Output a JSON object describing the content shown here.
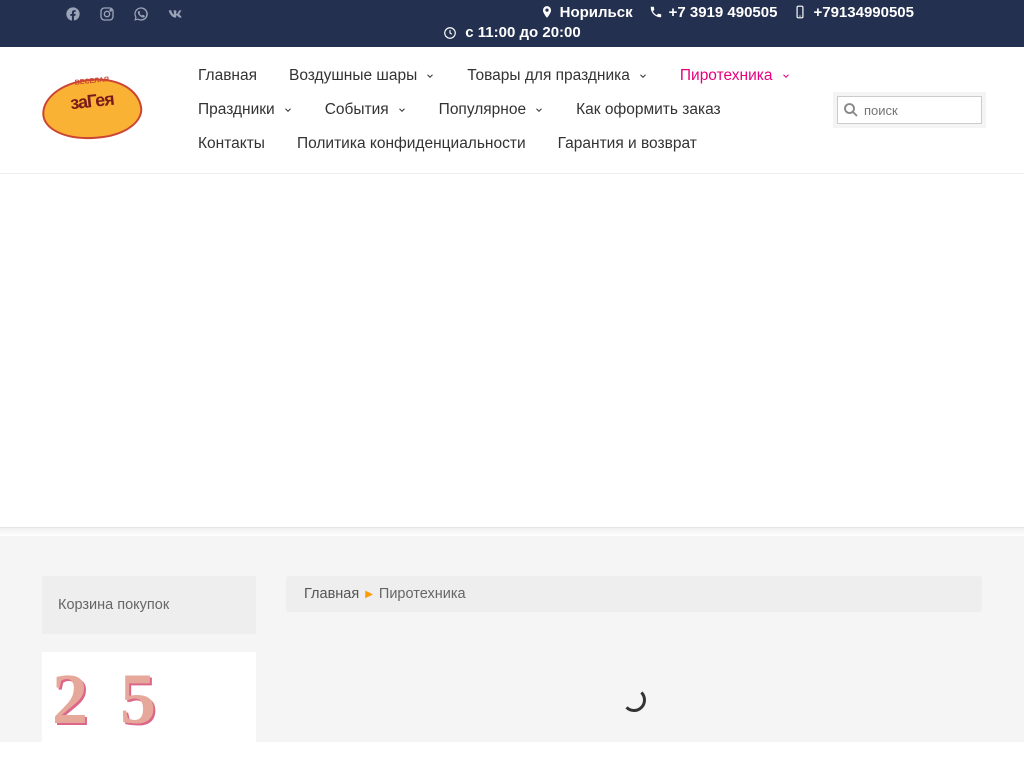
{
  "topbar": {
    "city": "Норильск",
    "phone1": "+7 3919 490505",
    "phone2": "+79134990505",
    "hours": "с 11:00 до 20:00"
  },
  "logo": {
    "main": "заГея",
    "sub": "ВЕСЕЛАЯ"
  },
  "nav": {
    "items": [
      {
        "label": "Главная",
        "dropdown": false,
        "active": false
      },
      {
        "label": "Воздушные шары",
        "dropdown": true,
        "active": false
      },
      {
        "label": "Товары для праздника",
        "dropdown": true,
        "active": false
      },
      {
        "label": "Пиротехника",
        "dropdown": true,
        "active": true
      },
      {
        "label": "Праздники",
        "dropdown": true,
        "active": false
      },
      {
        "label": "События",
        "dropdown": true,
        "active": false
      },
      {
        "label": "Популярное",
        "dropdown": true,
        "active": false
      },
      {
        "label": "Как оформить заказ",
        "dropdown": false,
        "active": false
      },
      {
        "label": "Контакты",
        "dropdown": false,
        "active": false
      },
      {
        "label": "Политика конфиденциальности",
        "dropdown": false,
        "active": false
      },
      {
        "label": "Гарантия и возврат",
        "dropdown": false,
        "active": false
      }
    ]
  },
  "search": {
    "placeholder": "поиск"
  },
  "sidebar": {
    "cart_title": "Корзина покупок",
    "promo_digit1": "2",
    "promo_digit2": "5"
  },
  "breadcrumb": {
    "home": "Главная",
    "current": "Пиротехника"
  }
}
